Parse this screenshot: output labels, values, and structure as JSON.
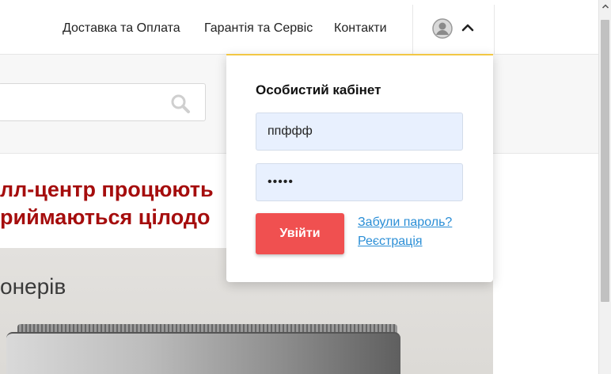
{
  "nav": {
    "links": [
      {
        "label": "Доставка та Оплата"
      },
      {
        "label": "Гарантія та Сервіс"
      },
      {
        "label": "Контакти"
      }
    ]
  },
  "search": {
    "placeholder": ""
  },
  "headline": {
    "line1": "лл-центр процюють",
    "line2": "риймаються цілодо"
  },
  "banner": {
    "text": "онерів"
  },
  "account": {
    "title": "Особистий кабінет",
    "login_value": "ппффф",
    "password_value": "•••••",
    "login_button": "Увійти",
    "forgot_link": "Забули пароль?",
    "register_link": "Реєстрація"
  },
  "colors": {
    "accent_red": "#f05050",
    "headline_red": "#a50d0d",
    "link_blue": "#2a8ed6",
    "input_bg": "#e8f0fe",
    "dropdown_border": "#f2c744"
  },
  "icons": {
    "user": "avatar-icon",
    "chevron": "chevron-up-icon",
    "search": "search-icon"
  }
}
